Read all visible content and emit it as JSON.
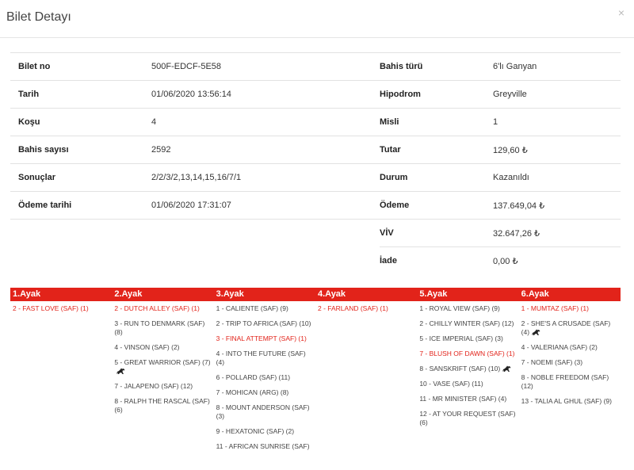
{
  "dialog": {
    "title": "Bilet Detayı",
    "close": "×"
  },
  "info": {
    "rows": [
      {
        "l1": "Bilet no",
        "v1": "500F-EDCF-5E58",
        "l2": "Bahis türü",
        "v2": "6'lı Ganyan"
      },
      {
        "l1": "Tarih",
        "v1": "01/06/2020 13:56:14",
        "l2": "Hipodrom",
        "v2": "Greyville"
      },
      {
        "l1": "Koşu",
        "v1": "4",
        "l2": "Misli",
        "v2": "1"
      },
      {
        "l1": "Bahis sayısı",
        "v1": "2592",
        "l2": "Tutar",
        "v2": "129,60 ₺"
      },
      {
        "l1": "Sonuçlar",
        "v1": "2/2/3/2,13,14,15,16/7/1",
        "l2": "Durum",
        "v2": "Kazanıldı"
      },
      {
        "l1": "Ödeme tarihi",
        "v1": "01/06/2020 17:31:07",
        "l2": "Ödeme",
        "v2": "137.649,04 ₺"
      },
      {
        "l1": "",
        "v1": "",
        "l2": "VİV",
        "v2": "32.647,26 ₺"
      },
      {
        "l1": "",
        "v1": "",
        "l2": "İade",
        "v2": "0,00 ₺"
      }
    ]
  },
  "legs": [
    {
      "title": "1.Ayak",
      "horses": [
        {
          "text": "2 - FAST LOVE (SAF) (1)",
          "win": true
        }
      ]
    },
    {
      "title": "2.Ayak",
      "horses": [
        {
          "text": "2 - DUTCH ALLEY (SAF) (1)",
          "win": true
        },
        {
          "text": "3 - RUN TO DENMARK (SAF) (8)",
          "win": false
        },
        {
          "text": "4 - VINSON (SAF) (2)",
          "win": false
        },
        {
          "text": "5 - GREAT WARRIOR (SAF) (7)",
          "win": false,
          "icon": "horse-icon"
        },
        {
          "text": "7 - JALAPENO (SAF) (12)",
          "win": false
        },
        {
          "text": "8 - RALPH THE RASCAL (SAF) (6)",
          "win": false
        }
      ]
    },
    {
      "title": "3.Ayak",
      "horses": [
        {
          "text": "1 - CALIENTE (SAF) (9)",
          "win": false
        },
        {
          "text": "2 - TRIP TO AFRICA (SAF) (10)",
          "win": false
        },
        {
          "text": "3 - FINAL ATTEMPT (SAF) (1)",
          "win": true
        },
        {
          "text": "4 - INTO THE FUTURE (SAF) (4)",
          "win": false
        },
        {
          "text": "6 - POLLARD (SAF) (11)",
          "win": false
        },
        {
          "text": "7 - MOHICAN (ARG) (8)",
          "win": false
        },
        {
          "text": "8 - MOUNT ANDERSON (SAF) (3)",
          "win": false
        },
        {
          "text": "9 - HEXATONIC (SAF) (2)",
          "win": false
        },
        {
          "text": "11 - AFRICAN SUNRISE (SAF)",
          "win": false
        }
      ]
    },
    {
      "title": "4.Ayak",
      "horses": [
        {
          "text": "2 - FARLAND (SAF) (1)",
          "win": true
        }
      ]
    },
    {
      "title": "5.Ayak",
      "horses": [
        {
          "text": "1 - ROYAL VIEW (SAF) (9)",
          "win": false
        },
        {
          "text": "2 - CHILLY WINTER (SAF) (12)",
          "win": false
        },
        {
          "text": "5 - ICE IMPERIAL (SAF) (3)",
          "win": false
        },
        {
          "text": "7 - BLUSH OF DAWN (SAF) (1)",
          "win": true
        },
        {
          "text": "8 - SANSKRIFT (SAF) (10)",
          "win": false,
          "icon": "horse-icon"
        },
        {
          "text": "10 - VASE (SAF) (11)",
          "win": false
        },
        {
          "text": "11 - MR MINISTER (SAF) (4)",
          "win": false
        },
        {
          "text": "12 - AT YOUR REQUEST (SAF) (6)",
          "win": false
        }
      ]
    },
    {
      "title": "6.Ayak",
      "horses": [
        {
          "text": "1 - MUMTAZ (SAF) (1)",
          "win": true
        },
        {
          "text": "2 - SHE'S A CRUSADE (SAF) (4)",
          "win": false,
          "icon": "horse-icon"
        },
        {
          "text": "4 - VALERIANA (SAF) (2)",
          "win": false
        },
        {
          "text": "7 - NOEMI (SAF) (3)",
          "win": false
        },
        {
          "text": "8 - NOBLE FREEDOM (SAF) (12)",
          "win": false
        },
        {
          "text": "13 - TALIA AL GHUL (SAF) (9)",
          "win": false
        }
      ]
    }
  ],
  "colors": {
    "accent": "#e2231a",
    "text": "#444444"
  }
}
